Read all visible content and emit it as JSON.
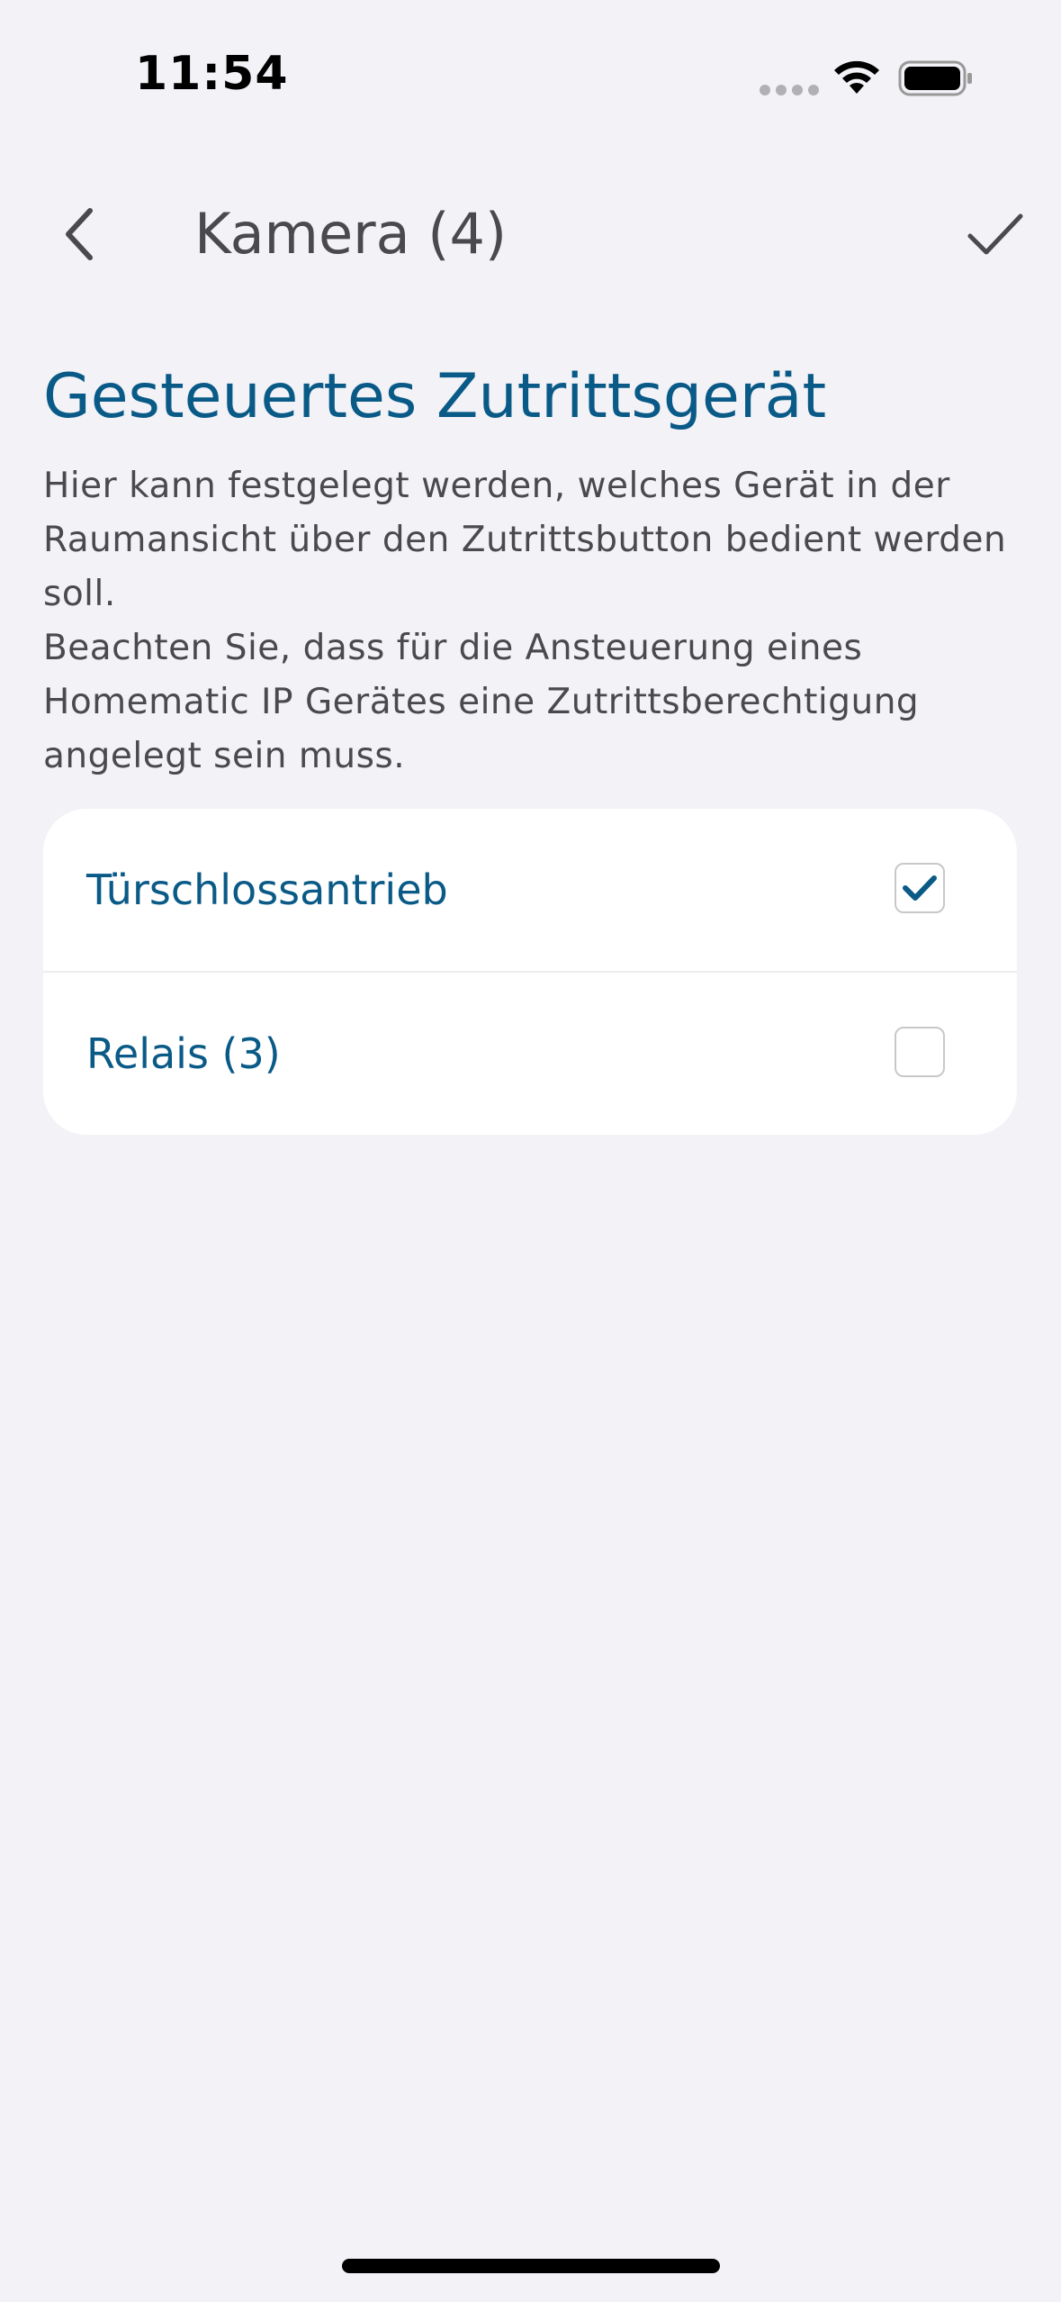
{
  "status_bar": {
    "time": "11:54",
    "signal_icon": "signal-dots-icon",
    "wifi_icon": "wifi-icon",
    "battery_icon": "battery-icon"
  },
  "nav": {
    "back_icon": "chevron-left-icon",
    "title": "Kamera (4)",
    "confirm_icon": "checkmark-icon"
  },
  "section": {
    "heading": "Gesteuertes Zutrittsgerät",
    "description_1": "Hier kann festgelegt werden, welches Gerät in der Raumansicht über den Zutrittsbutton bedient werden soll.",
    "description_2": "Beachten Sie, dass für die Ansteuerung eines Homematic IP Gerätes eine Zutrittsberechtigung angelegt sein muss."
  },
  "options": [
    {
      "label": "Türschlossantrieb",
      "checked": true
    },
    {
      "label": "Relais (3)",
      "checked": false
    }
  ],
  "colors": {
    "background": "#f2f2f7",
    "accent": "#0a5a87",
    "text_secondary": "#4a4a4e",
    "card": "#ffffff"
  }
}
